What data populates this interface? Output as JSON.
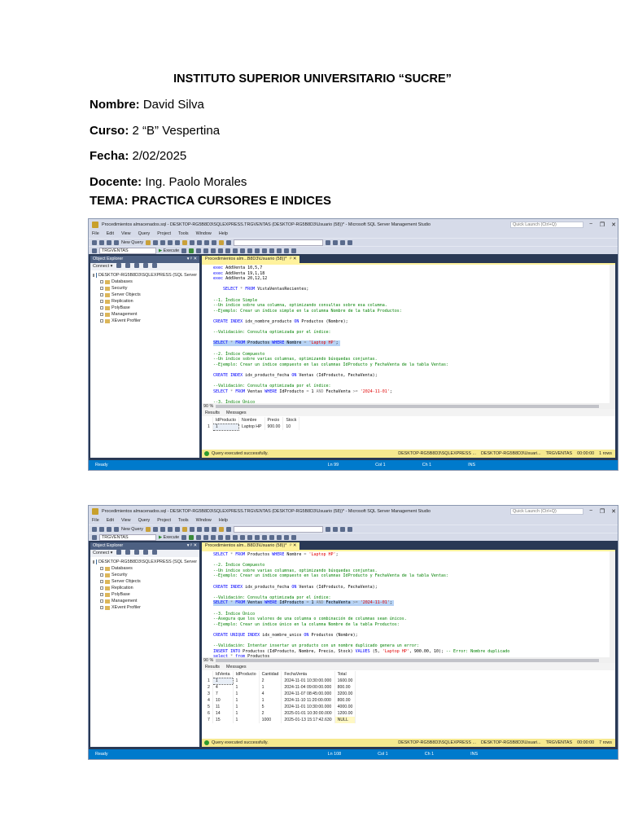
{
  "document": {
    "institution": "INSTITUTO SUPERIOR UNIVERSITARIO “SUCRE”",
    "fields": [
      {
        "label": "Nombre:",
        "value": "David Silva"
      },
      {
        "label": "Curso:",
        "value": "2 “B” Vespertina"
      },
      {
        "label": "Fecha:",
        "value": "2/02/2025"
      },
      {
        "label": "Docente:",
        "value": "Ing. Paolo Morales"
      }
    ],
    "tema": "TEMA: PRACTICA CURSORES E INDICES"
  },
  "windows": [
    {
      "title": "Procedimientos almacenados.sql - DESKTOP-RG5B8D3\\SQLEXPRESS.TRGVENTAS (DESKTOP-RG5B8D3\\Usuario (58))* - Microsoft SQL Server Management Studio",
      "quick_launch": "Quick Launch (Ctrl+Q)",
      "menu": [
        "File",
        "Edit",
        "View",
        "Query",
        "Project",
        "Tools",
        "Window",
        "Help"
      ],
      "new_query": "New Query",
      "database": "TRGVENTAS",
      "execute": "Execute",
      "explorer": {
        "title": "Object Explorer",
        "pin": "▾ ᵖ ✕",
        "connect": "Connect ▾",
        "server": "DESKTOP-RG5B8D3\\SQLEXPRESS (SQL Server",
        "nodes": [
          "Databases",
          "Security",
          "Server Objects",
          "Replication",
          "PolyBase",
          "Management",
          "XEvent Profiler"
        ]
      },
      "tab_title": "Procedimientos alm...B8D3\\Usuario (58))*",
      "zoom_level": "90 %",
      "results_tab": "Results",
      "messages_tab": "Messages",
      "code": [
        [
          [
            "k",
            "exec "
          ],
          [
            "p",
            "AddVenta 10,5,7"
          ]
        ],
        [
          [
            "k",
            "exec "
          ],
          [
            "p",
            "AddVenta 19,1,18"
          ]
        ],
        [
          [
            "k",
            "exec "
          ],
          [
            "p",
            "AddVenta 20,12,12"
          ]
        ],
        [],
        [
          [
            "p",
            "    "
          ],
          [
            "k",
            "SELECT "
          ],
          [
            "g",
            "* "
          ],
          [
            "k",
            "FROM "
          ],
          [
            "p",
            "VistaVentasRecientes;"
          ]
        ],
        [],
        [
          [
            "c",
            "--1. Índice Simple"
          ]
        ],
        [
          [
            "c",
            "--Un índice sobre una columna, optimizando consultas sobre esa columna."
          ]
        ],
        [
          [
            "c",
            "--Ejemplo: Crear un índice simple en la columna Nombre de la tabla Productos:"
          ]
        ],
        [],
        [
          [
            "k",
            "CREATE INDEX "
          ],
          [
            "p",
            "idx_nombre_producto "
          ],
          [
            "k",
            "ON "
          ],
          [
            "p",
            "Productos (Nombre);"
          ]
        ],
        [],
        [
          [
            "c",
            "--Validación: Consulta optimizada por el índice:"
          ]
        ],
        [],
        {
          "hl": true,
          "t": [
            [
              "k",
              "SELECT "
            ],
            [
              "g",
              "* "
            ],
            [
              "k",
              "FROM "
            ],
            [
              "p",
              "Productos "
            ],
            [
              "k",
              "WHERE "
            ],
            [
              "p",
              "Nombre "
            ],
            [
              "g",
              "= "
            ],
            [
              "s",
              "'Laptop HP'"
            ],
            [
              "p",
              ";"
            ]
          ]
        },
        [],
        [
          [
            "c",
            "--2. Índice Compuesto"
          ]
        ],
        [
          [
            "c",
            "--Un índice sobre varias columnas, optimizando búsquedas conjuntas."
          ]
        ],
        [
          [
            "c",
            "--Ejemplo: Crear un índice compuesto en las columnas IdProducto y FechaVenta de la tabla Ventas:"
          ]
        ],
        [],
        [
          [
            "k",
            "CREATE INDEX "
          ],
          [
            "p",
            "idx_producto_fecha "
          ],
          [
            "k",
            "ON "
          ],
          [
            "p",
            "Ventas (IdProducto, FechaVenta);"
          ]
        ],
        [],
        [
          [
            "c",
            "--Validación: Consulta optimizada por el índice:"
          ]
        ],
        [
          [
            "k",
            "SELECT "
          ],
          [
            "g",
            "* "
          ],
          [
            "k",
            "FROM "
          ],
          [
            "p",
            "Ventas "
          ],
          [
            "k",
            "WHERE "
          ],
          [
            "p",
            "IdProducto "
          ],
          [
            "g",
            "= "
          ],
          [
            "p",
            "1 "
          ],
          [
            "g",
            "AND "
          ],
          [
            "p",
            "FechaVenta "
          ],
          [
            "g",
            ">= "
          ],
          [
            "s",
            "'2024-11-01'"
          ],
          [
            "p",
            ";"
          ]
        ],
        [],
        [
          [
            "c",
            "--3. Índice Único"
          ]
        ]
      ],
      "grid": {
        "columns": [
          "IdProducto",
          "Nombre",
          "Precio",
          "Stock"
        ],
        "rows": [
          [
            "1",
            "1",
            "Laptop HP",
            "900.00",
            "10"
          ]
        ]
      },
      "status": {
        "message": "Query executed successfully.",
        "server": "DESKTOP-RG5B8D3\\SQLEXPRESS ...",
        "user": "DESKTOP-RG5B8D3\\Usuari...",
        "db": "TRGVENTAS",
        "time": "00:00:00",
        "rows": "1 rows"
      },
      "statusbar": {
        "ready": "Ready",
        "ln": "Ln 99",
        "col": "Col 1",
        "ch": "Ch 1",
        "ins": "INS"
      }
    },
    {
      "title": "Procedimientos almacenados.sql - DESKTOP-RG5B8D3\\SQLEXPRESS.TRGVENTAS (DESKTOP-RG5B8D3\\Usuario (58))* - Microsoft SQL Server Management Studio",
      "quick_launch": "Quick Launch (Ctrl+Q)",
      "menu": [
        "File",
        "Edit",
        "View",
        "Query",
        "Project",
        "Tools",
        "Window",
        "Help"
      ],
      "new_query": "New Query",
      "database": "TRGVENTAS",
      "execute": "Execute",
      "explorer": {
        "title": "Object Explorer",
        "pin": "▾ ᵖ ✕",
        "connect": "Connect ▾",
        "server": "DESKTOP-RG5B8D3\\SQLEXPRESS (SQL Server",
        "nodes": [
          "Databases",
          "Security",
          "Server Objects",
          "Replication",
          "PolyBase",
          "Management",
          "XEvent Profiler"
        ]
      },
      "tab_title": "Procedimientos alm...B8D3\\Usuario (58))*",
      "zoom_level": "90 %",
      "results_tab": "Results",
      "messages_tab": "Messages",
      "code": [
        [
          [
            "k",
            "SELECT "
          ],
          [
            "g",
            "* "
          ],
          [
            "k",
            "FROM "
          ],
          [
            "p",
            "Productos "
          ],
          [
            "k",
            "WHERE "
          ],
          [
            "p",
            "Nombre "
          ],
          [
            "g",
            "= "
          ],
          [
            "s",
            "'Laptop HP'"
          ],
          [
            "p",
            ";"
          ]
        ],
        [],
        [
          [
            "c",
            "--2. Índice Compuesto"
          ]
        ],
        [
          [
            "c",
            "--Un índice sobre varias columnas, optimizando búsquedas conjuntas."
          ]
        ],
        [
          [
            "c",
            "--Ejemplo: Crear un índice compuesto en las columnas IdProducto y FechaVenta de la tabla Ventas:"
          ]
        ],
        [],
        [
          [
            "k",
            "CREATE INDEX "
          ],
          [
            "p",
            "idx_producto_fecha "
          ],
          [
            "k",
            "ON "
          ],
          [
            "p",
            "Ventas (IdProducto, FechaVenta);"
          ]
        ],
        [],
        [
          [
            "c",
            "--Validación: Consulta optimizada por el índice:"
          ]
        ],
        {
          "hl": true,
          "t": [
            [
              "k",
              "SELECT "
            ],
            [
              "g",
              "* "
            ],
            [
              "k",
              "FROM "
            ],
            [
              "p",
              "Ventas "
            ],
            [
              "k",
              "WHERE "
            ],
            [
              "p",
              "IdProducto "
            ],
            [
              "g",
              "= "
            ],
            [
              "p",
              "1 "
            ],
            [
              "g",
              "AND "
            ],
            [
              "p",
              "FechaVenta "
            ],
            [
              "g",
              ">= "
            ],
            [
              "s",
              "'2024-11-01'"
            ],
            [
              "p",
              ";"
            ]
          ]
        },
        [],
        [
          [
            "c",
            "--3. Índice Único"
          ]
        ],
        [
          [
            "c",
            "--Asegura que los valores de una columna o combinación de columnas sean únicos."
          ]
        ],
        [
          [
            "c",
            "--Ejemplo: Crear un índice único en la columna Nombre de la tabla Productos:"
          ]
        ],
        [],
        [
          [
            "k",
            "CREATE UNIQUE INDEX "
          ],
          [
            "p",
            "idx_nombre_unico "
          ],
          [
            "k",
            "ON "
          ],
          [
            "p",
            "Productos (Nombre);"
          ]
        ],
        [],
        [
          [
            "c",
            "--Validación: Intentar insertar un producto con un nombre duplicado genera un error:"
          ]
        ],
        [
          [
            "k",
            "INSERT INTO "
          ],
          [
            "p",
            "Productos (IdProducto, Nombre, Precio, Stock) "
          ],
          [
            "k",
            "VALUES "
          ],
          [
            "p",
            "(5, "
          ],
          [
            "s",
            "'Laptop HP'"
          ],
          [
            "p",
            ", 900.00, 10); "
          ],
          [
            "c",
            "-- Error: Nombre duplicado"
          ]
        ],
        [
          [
            "k",
            "select "
          ],
          [
            "g",
            "* "
          ],
          [
            "k",
            "from "
          ],
          [
            "p",
            "Productos"
          ]
        ]
      ],
      "grid": {
        "columns": [
          "IdVenta",
          "IdProducto",
          "Cantidad",
          "FechaVenta",
          "Total"
        ],
        "rows": [
          [
            "1",
            "1",
            "1",
            "2",
            "2024-11-01 10:30:00.000",
            "1600.00"
          ],
          [
            "2",
            "4",
            "1",
            "1",
            "2024-11-04 09:00:00.000",
            "800.00"
          ],
          [
            "3",
            "7",
            "1",
            "4",
            "2024-11-07 08:45:00.000",
            "3200.00"
          ],
          [
            "4",
            "10",
            "1",
            "1",
            "2024-11-10 11:20:00.000",
            "800.00"
          ],
          [
            "5",
            "11",
            "1",
            "5",
            "2024-11-01 10:30:00.000",
            "4000.00"
          ],
          [
            "6",
            "14",
            "1",
            "2",
            "2025-01-01 10:30:00.000",
            "1200.00"
          ],
          [
            "7",
            "15",
            "1",
            "1000",
            "2025-01-13 15:17:42.630",
            "NULL"
          ]
        ]
      },
      "status": {
        "message": "Query executed successfully.",
        "server": "DESKTOP-RG5B8D3\\SQLEXPRESS ...",
        "user": "DESKTOP-RG5B8D3\\Usuari...",
        "db": "TRGVENTAS",
        "time": "00:00:00",
        "rows": "7 rows"
      },
      "statusbar": {
        "ready": "Ready",
        "ln": "Ln 108",
        "col": "Col 1",
        "ch": "Ch 1",
        "ins": "INS"
      }
    }
  ]
}
